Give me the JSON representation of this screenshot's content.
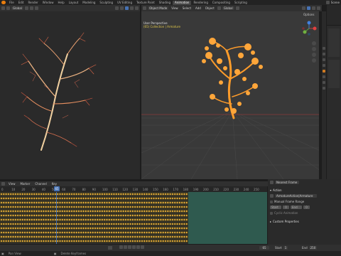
{
  "topbar": {
    "menus": [
      "File",
      "Edit",
      "Render",
      "Window",
      "Help"
    ],
    "workspaces": [
      "Layout",
      "Modeling",
      "Sculpting",
      "UV Editing",
      "Texture Paint",
      "Shading",
      "Animation",
      "Rendering",
      "Compositing",
      "Scripting"
    ],
    "active_workspace": "Animation",
    "scene": "Scene"
  },
  "left_viewport": {
    "transform": "Global",
    "options": "Options"
  },
  "right_viewport": {
    "mode": "Object Mode",
    "menus": [
      "View",
      "Select",
      "Add",
      "Object"
    ],
    "transform": "Global",
    "options": "Options",
    "info_line1": "User Perspective",
    "info_line2": "(65) Collection | Armature"
  },
  "timeline": {
    "menus": [
      "View",
      "Marker",
      "Channel",
      "Key"
    ],
    "current_frame": "65",
    "ticks": [
      "0",
      "10",
      "20",
      "30",
      "40",
      "50",
      "60",
      "70",
      "80",
      "90",
      "100",
      "110",
      "120",
      "130",
      "140",
      "150",
      "160",
      "170",
      "180",
      "190",
      "200",
      "210",
      "220",
      "230",
      "240",
      "250"
    ]
  },
  "npanel": {
    "dropdown": "Nearest Frame",
    "section_action": "Action",
    "action_name": "ArmatureAction|Armature",
    "manual_frame_range": "Manual Frame Range",
    "start_label": "Start",
    "start_val": "0",
    "end_label": "End",
    "end_val": "0",
    "cyclic_label": "Cyclic Animation",
    "section_custom": "Custom Properties"
  },
  "playback": {
    "current": "65",
    "start_label": "Start",
    "start": "1",
    "end_label": "End",
    "end": "250"
  },
  "status": {
    "left": "Pan View",
    "right": "Delete Keyframes"
  }
}
